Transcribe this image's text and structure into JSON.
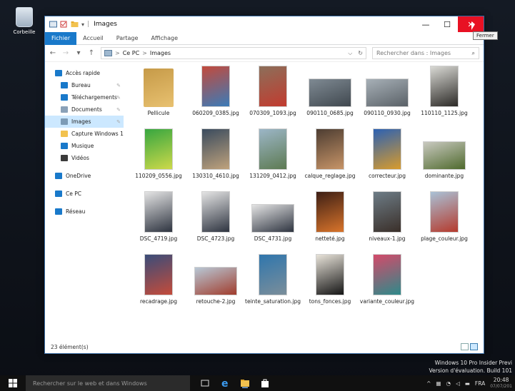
{
  "desktop": {
    "icon_label": "Corbeille"
  },
  "window": {
    "title": "Images",
    "controls": {
      "minimize": "—",
      "maximize": "☐",
      "close": "✕"
    },
    "tooltip": "Fermer"
  },
  "ribbon": {
    "tabs": [
      "Fichier",
      "Accueil",
      "Partage",
      "Affichage"
    ]
  },
  "address": {
    "back": "←",
    "forward": "→",
    "recent": "▾",
    "up": "↑",
    "path": [
      "Ce PC",
      "Images"
    ],
    "separator": ">",
    "dropdown": "⌵",
    "refresh": "↻",
    "search_placeholder": "Rechercher dans : Images",
    "search_icon": "⌕"
  },
  "nav": {
    "items": [
      {
        "label": "Accès rapide",
        "icon": "star-icon",
        "color": "#1979ca",
        "indent": false,
        "pinned": false
      },
      {
        "label": "Bureau",
        "icon": "desktop-icon",
        "color": "#1979ca",
        "indent": true,
        "pinned": true
      },
      {
        "label": "Téléchargements",
        "icon": "download-icon",
        "color": "#1979ca",
        "indent": true,
        "pinned": true
      },
      {
        "label": "Documents",
        "icon": "documents-icon",
        "color": "#8aa1b8",
        "indent": true,
        "pinned": true
      },
      {
        "label": "Images",
        "icon": "pictures-icon",
        "color": "#7d9bb6",
        "indent": true,
        "pinned": true,
        "selected": true
      },
      {
        "label": "Capture Windows 1",
        "icon": "folder-icon",
        "color": "#f2c24f",
        "indent": true,
        "pinned": false
      },
      {
        "label": "Musique",
        "icon": "music-icon",
        "color": "#1979ca",
        "indent": true,
        "pinned": false
      },
      {
        "label": "Vidéos",
        "icon": "videos-icon",
        "color": "#3b3b3b",
        "indent": true,
        "pinned": false
      },
      {
        "gap": true
      },
      {
        "label": "OneDrive",
        "icon": "onedrive-icon",
        "color": "#1979ca",
        "indent": false,
        "pinned": false
      },
      {
        "gap": true
      },
      {
        "label": "Ce PC",
        "icon": "pc-icon",
        "color": "#1979ca",
        "indent": false,
        "pinned": false
      },
      {
        "gap": true
      },
      {
        "label": "Réseau",
        "icon": "network-icon",
        "color": "#1979ca",
        "indent": false,
        "pinned": false
      }
    ],
    "pin_glyph": "✎"
  },
  "files": [
    {
      "name": "Pellicule",
      "kind": "folder",
      "colors": [
        "#c69a48",
        "#e8c170"
      ]
    },
    {
      "name": "060209_0385.jpg",
      "kind": "tall",
      "colors": [
        "#c34a3c",
        "#3a7bb8"
      ]
    },
    {
      "name": "070309_1093.jpg",
      "kind": "tall",
      "colors": [
        "#8c6f5a",
        "#c23b2f"
      ]
    },
    {
      "name": "090110_0685.jpg",
      "kind": "wide",
      "colors": [
        "#7f8a93",
        "#40484f"
      ]
    },
    {
      "name": "090110_0930.jpg",
      "kind": "wide",
      "colors": [
        "#a7b0b7",
        "#5a6167"
      ]
    },
    {
      "name": "110110_1125.jpg",
      "kind": "tall",
      "colors": [
        "#d9d9d4",
        "#2c2a27"
      ]
    },
    {
      "name": "110209_0556.jpg",
      "kind": "tall",
      "colors": [
        "#37a640",
        "#cdd94a"
      ]
    },
    {
      "name": "130310_4610.jpg",
      "kind": "tall",
      "colors": [
        "#3a4b5e",
        "#bfa27c"
      ]
    },
    {
      "name": "131209_0412.jpg",
      "kind": "tall",
      "colors": [
        "#9cb6c7",
        "#5d7a52"
      ]
    },
    {
      "name": "calque_reglage.jpg",
      "kind": "tall",
      "colors": [
        "#4d3d32",
        "#c79467"
      ]
    },
    {
      "name": "correcteur.jpg",
      "kind": "tall",
      "colors": [
        "#2c61b3",
        "#d89b2c"
      ]
    },
    {
      "name": "dominante.jpg",
      "kind": "wide",
      "colors": [
        "#c9c9c0",
        "#4f6a2d"
      ]
    },
    {
      "name": "DSC_4719.jpg",
      "kind": "tall",
      "colors": [
        "#e4e4e4",
        "#2e3440"
      ]
    },
    {
      "name": "DSC_4723.jpg",
      "kind": "tall",
      "colors": [
        "#e4e4e4",
        "#2e3440"
      ]
    },
    {
      "name": "DSC_4731.jpg",
      "kind": "wide",
      "colors": [
        "#e4e4e4",
        "#2e3440"
      ]
    },
    {
      "name": "netteté.jpg",
      "kind": "tall",
      "colors": [
        "#3d1f15",
        "#d9742b"
      ]
    },
    {
      "name": "niveaux-1.jpg",
      "kind": "tall",
      "colors": [
        "#6d7c86",
        "#3a2f29"
      ]
    },
    {
      "name": "plage_couleur.jpg",
      "kind": "tall",
      "colors": [
        "#a9c1d6",
        "#b53a2d"
      ]
    },
    {
      "name": "recadrage.jpg",
      "kind": "tall",
      "colors": [
        "#3a4d7a",
        "#c44b3a"
      ]
    },
    {
      "name": "retouche-2.jpg",
      "kind": "wide",
      "colors": [
        "#b8c8d6",
        "#a13d2d"
      ]
    },
    {
      "name": "teinte_saturation.jpg",
      "kind": "tall",
      "colors": [
        "#2f76ad",
        "#7b8e9a"
      ]
    },
    {
      "name": "tons_fonces.jpg",
      "kind": "tall",
      "colors": [
        "#e8e3d9",
        "#151515"
      ]
    },
    {
      "name": "variante_couleur.jpg",
      "kind": "tall",
      "colors": [
        "#d44a6a",
        "#2e8a8a"
      ]
    }
  ],
  "status": {
    "count": "23 élément(s)"
  },
  "watermark": [
    "Windows 10 Pro Insider Previ",
    "Version d'évaluation. Build 101"
  ],
  "taskbar": {
    "search_placeholder": "Rechercher sur le web et dans Windows",
    "tray_text": "FRA",
    "time": "20:48",
    "date": "07/07/201"
  },
  "colors": {
    "accent": "#1979ca",
    "close_red": "#e81123",
    "selection": "#cce8ff"
  }
}
